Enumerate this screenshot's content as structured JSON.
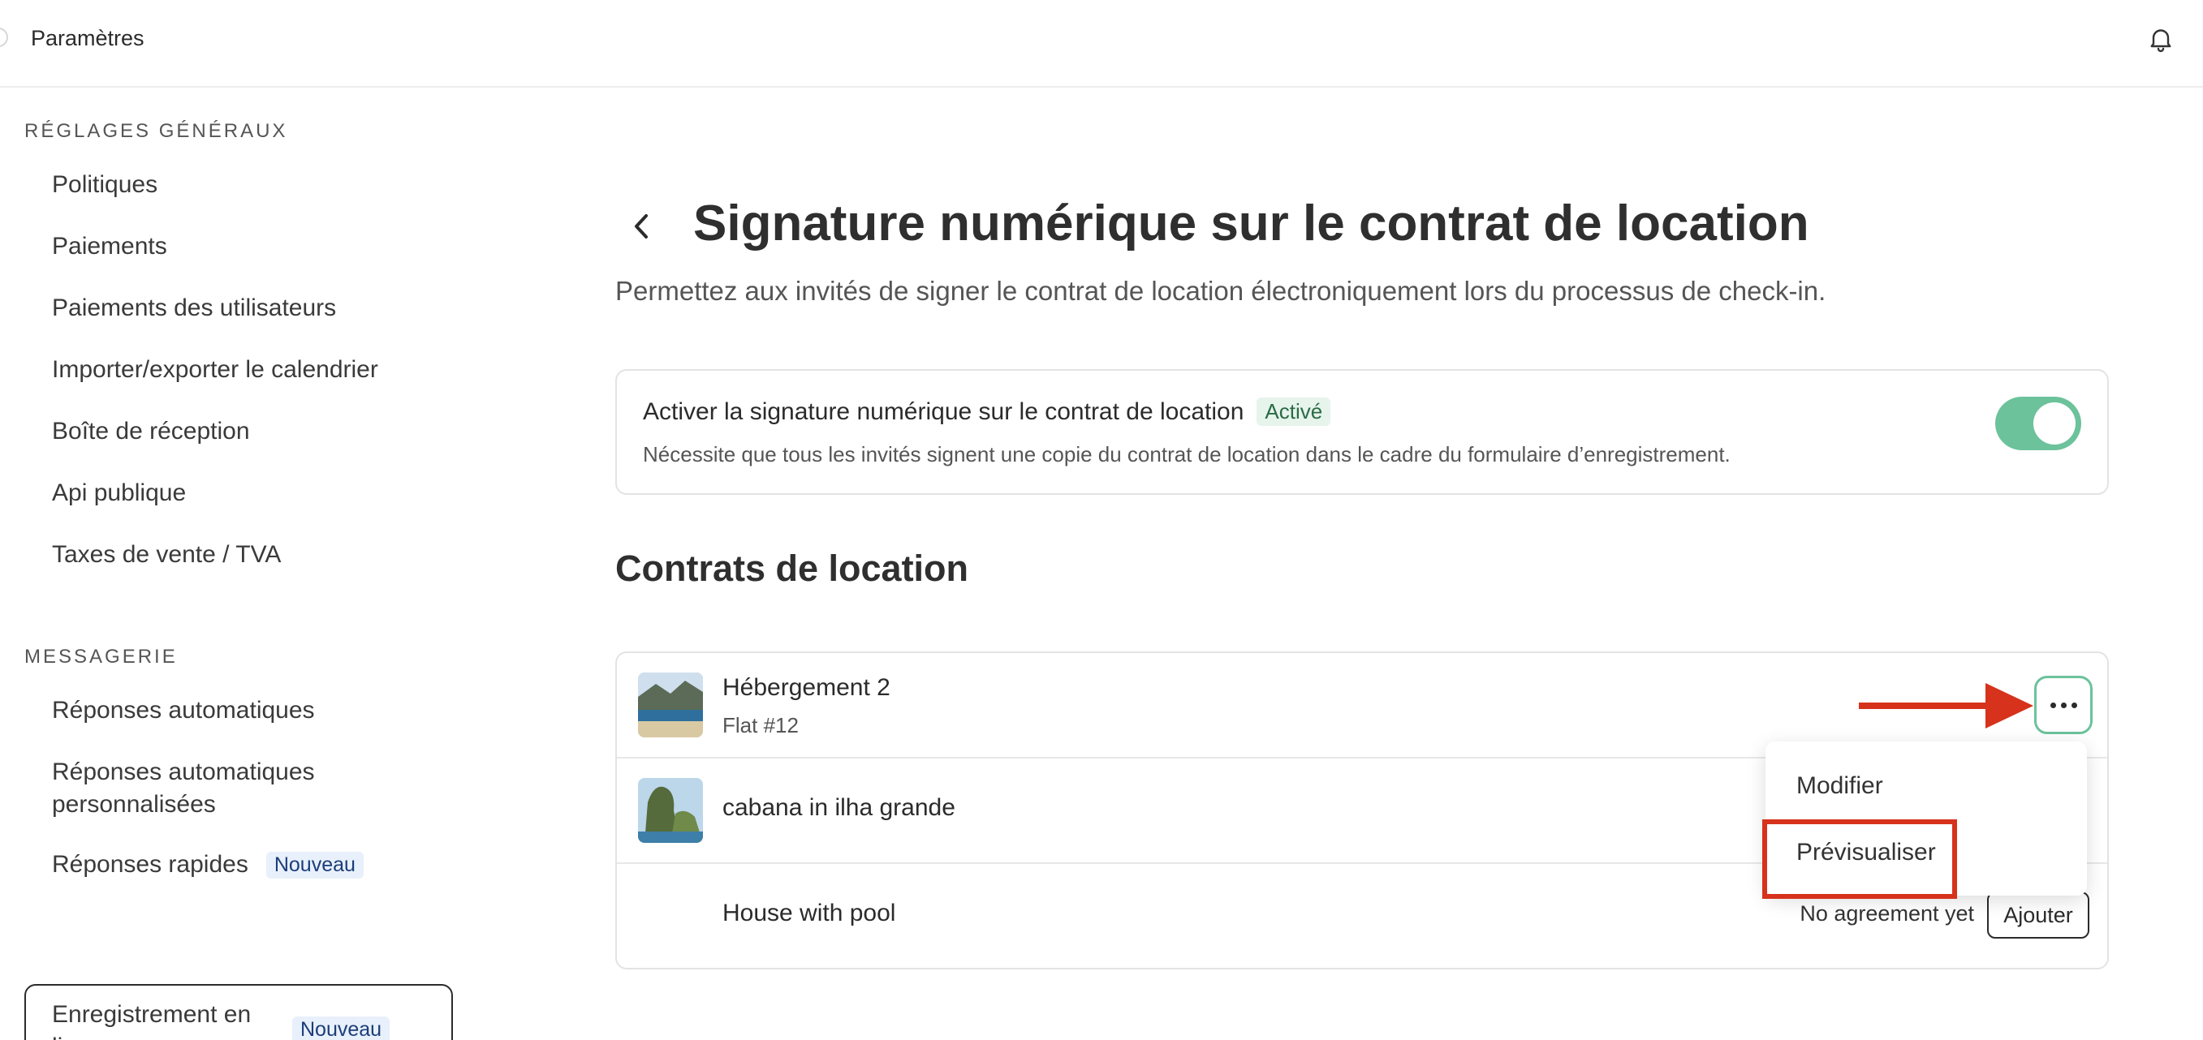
{
  "header": {
    "title": "Paramètres",
    "bell_icon": "bell-icon"
  },
  "sidebar": {
    "general_title": "RÉGLAGES GÉNÉRAUX",
    "general_items": [
      {
        "label": "Politiques"
      },
      {
        "label": "Paiements"
      },
      {
        "label": "Paiements des utilisateurs"
      },
      {
        "label": "Importer/exporter le calendrier"
      },
      {
        "label": "Boîte de réception"
      },
      {
        "label": "Api publique"
      },
      {
        "label": "Taxes de vente / TVA"
      }
    ],
    "messaging_title": "MESSAGERIE",
    "messaging_items": [
      {
        "label_line1": "Réponses automatiques"
      },
      {
        "label_line1": "Réponses automatiques",
        "label_line2": "personnalisées"
      },
      {
        "label_line1": "Réponses rapides",
        "badge": "Nouveau"
      },
      {
        "label_line1": "Enregistrement en",
        "label_line2": "ligne",
        "badge": "Nouveau",
        "selected": true
      }
    ]
  },
  "main": {
    "title": "Signature numérique sur le contrat de location",
    "subtitle": "Permettez aux invités de signer le contrat de location électroniquement lors du processus de check-in.",
    "toggle_card": {
      "label": "Activer la signature numérique sur le contrat de location",
      "status": "Activé",
      "description": "Nécessite que tous les invités signent une copie du contrat de location dans le cadre du formulaire d’enregistrement.",
      "enabled": true
    },
    "contracts_heading": "Contrats de location",
    "contracts": [
      {
        "title": "Hébergement 2",
        "subtitle": "Flat #12"
      },
      {
        "title": "cabana in ilha grande"
      },
      {
        "title": "House with pool",
        "status": "No agreement yet",
        "add_label": "Ajouter"
      }
    ]
  },
  "menu": {
    "items": [
      {
        "label": "Modifier"
      },
      {
        "label": "Prévisualiser"
      }
    ]
  },
  "colors": {
    "accent_green": "#6cc29b",
    "annotation_red": "#d6321c",
    "badge_bg": "#e8f0fb",
    "status_bg": "#e6f4ec"
  }
}
